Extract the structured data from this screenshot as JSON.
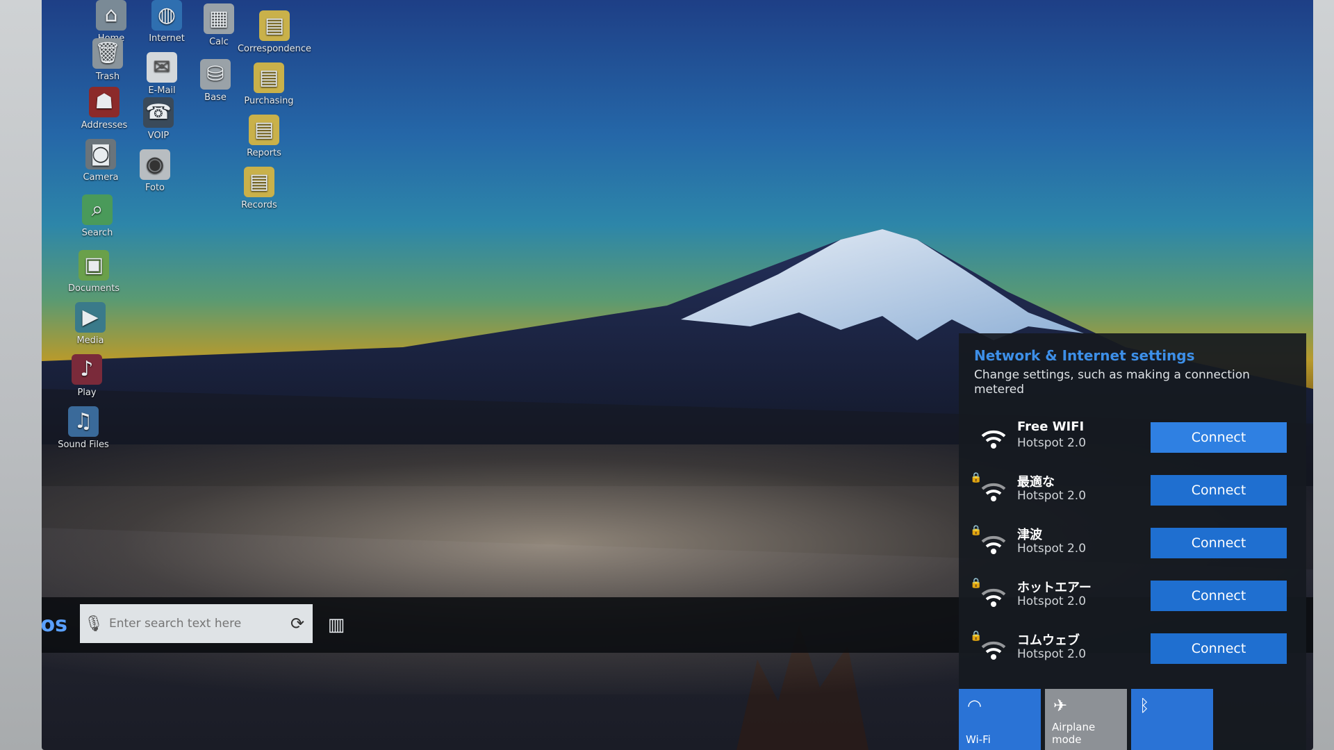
{
  "desktop": {
    "icons": [
      {
        "label": "Home",
        "icon": "home-icon"
      },
      {
        "label": "Internet",
        "icon": "globe-icon"
      },
      {
        "label": "Calc",
        "icon": "calculator-icon"
      },
      {
        "label": "Correspondence",
        "icon": "folder-icon"
      },
      {
        "label": "Trash",
        "icon": "trash-icon"
      },
      {
        "label": "E-Mail",
        "icon": "mail-icon"
      },
      {
        "label": "Base",
        "icon": "database-icon"
      },
      {
        "label": "Purchasing",
        "icon": "folder-icon"
      },
      {
        "label": "Addresses",
        "icon": "address-book-icon"
      },
      {
        "label": "VOIP",
        "icon": "phone-icon"
      },
      {
        "label": "Camera",
        "icon": "camera-icon"
      },
      {
        "label": "Foto",
        "icon": "photo-icon"
      },
      {
        "label": "Reports",
        "icon": "folder-icon"
      },
      {
        "label": "Records",
        "icon": "folder-icon"
      },
      {
        "label": "Search",
        "icon": "search-icon"
      },
      {
        "label": "Documents",
        "icon": "documents-icon"
      },
      {
        "label": "Media",
        "icon": "media-icon"
      },
      {
        "label": "Play",
        "icon": "play-icon"
      },
      {
        "label": "Sound Files",
        "icon": "sound-icon"
      }
    ]
  },
  "taskbar": {
    "start_label": "Qos",
    "search_placeholder": "Enter search text here",
    "mic_icon": "microphone-icon",
    "refresh_icon": "refresh-icon",
    "taskview_icon": "task-view-icon"
  },
  "flyout": {
    "title": "Network & Internet settings",
    "description": "Change settings, such as making a connection metered",
    "networks": [
      {
        "ssid": "Free WIFI",
        "type": "Hotspot 2.0",
        "locked": false,
        "button": "Connect"
      },
      {
        "ssid": "最適な",
        "type": "Hotspot 2.0",
        "locked": true,
        "button": "Connect"
      },
      {
        "ssid": "津波",
        "type": "Hotspot 2.0",
        "locked": true,
        "button": "Connect"
      },
      {
        "ssid": "ホットエアー",
        "type": "Hotspot 2.0",
        "locked": true,
        "button": "Connect"
      },
      {
        "ssid": "コムウェブ",
        "type": "Hotspot 2.0",
        "locked": true,
        "button": "Connect"
      }
    ],
    "quick_actions": [
      {
        "label": "Wi-Fi",
        "icon": "wifi-icon",
        "active": true
      },
      {
        "label": "Airplane mode",
        "icon": "airplane-icon",
        "active": false
      },
      {
        "label": "",
        "icon": "bluetooth-icon",
        "active": true
      }
    ]
  },
  "colors": {
    "accent": "#1f6fd0",
    "flyout_title": "#3d8fe8"
  }
}
